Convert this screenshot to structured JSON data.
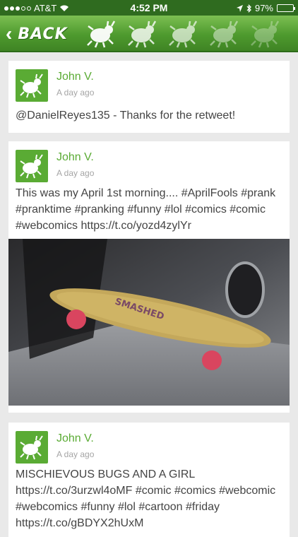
{
  "status": {
    "carrier": "AT&T",
    "time": "4:52 PM",
    "battery": "97%",
    "battery_level": 0.97
  },
  "nav": {
    "back_label": "BACK",
    "icons": [
      "bug-icon",
      "bug-icon",
      "bug-icon",
      "bug-icon",
      "bug-icon"
    ]
  },
  "posts": [
    {
      "author": "John V.",
      "time": "A day ago",
      "text": "@DanielReyes135 - Thanks for the retweet!"
    },
    {
      "author": "John V.",
      "time": "A day ago",
      "text": "This was my April 1st morning.... #AprilFools #prank #pranktime #pranking #funny #lol #comics #comic #webcomics https://t.co/yozd4zylYr",
      "photo_text": "SMASHED"
    },
    {
      "author": "John V.",
      "time": "A day ago",
      "text": "MISCHIEVOUS BUGS AND A GIRL https://t.co/3urzwl4oMF #comic #comics #webcomic #webcomics #funny #lol #cartoon #friday https://t.co/gBDYX2hUxM"
    }
  ],
  "colors": {
    "nav_green": "#4e9a2e",
    "accent_green": "#5aab34",
    "status_bar": "#2f6b1f"
  }
}
